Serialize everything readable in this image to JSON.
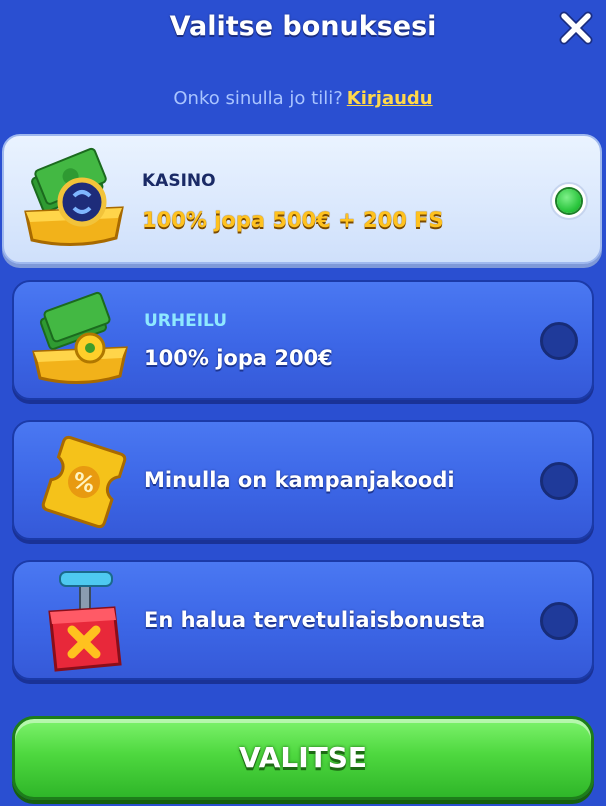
{
  "header": {
    "title": "Valitse bonuksesi",
    "close_icon": "close-icon"
  },
  "login_prompt": {
    "question": "Onko sinulla jo tili?",
    "link": "Kirjaudu"
  },
  "options": [
    {
      "tag": "KASINO",
      "text": "100% jopa 500€ + 200 FS",
      "icon": "cash-tray-casino-icon",
      "selected": true
    },
    {
      "tag": "URHEILU",
      "text": "100% jopa 200€",
      "icon": "cash-tray-football-icon",
      "selected": false
    },
    {
      "tag": "",
      "text": "Minulla on kampanjakoodi",
      "icon": "coupon-percent-icon",
      "selected": false
    },
    {
      "tag": "",
      "text": "En halua tervetuliaisbonusta",
      "icon": "detonator-box-icon",
      "selected": false
    }
  ],
  "submit": {
    "label": "VALITSE"
  },
  "colors": {
    "background": "#2a4fd1",
    "selected_text": "#ffc21f",
    "casino_tag": "#1a2a66",
    "sport_tag": "#8fe8ff",
    "link": "#ffd84a",
    "button": "#4ed83f",
    "radio_on": "#28c43b"
  }
}
